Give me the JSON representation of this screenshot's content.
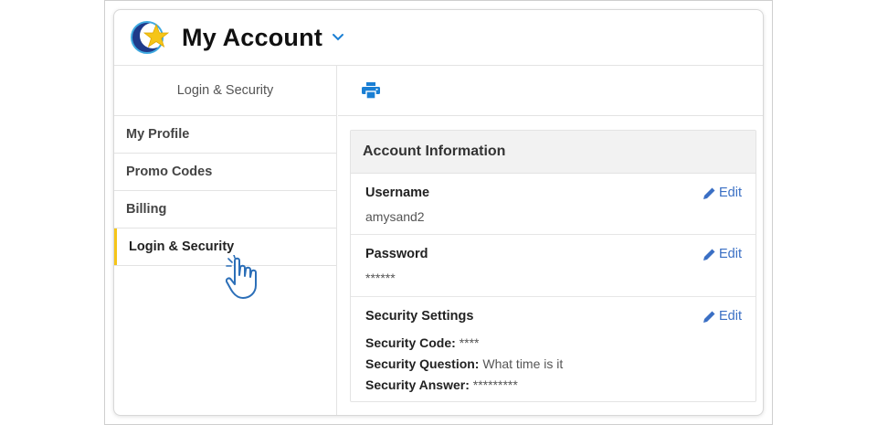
{
  "header": {
    "title": "My Account",
    "logo_icon": "star-crescent-logo",
    "dropdown_icon": "chevron-down-icon"
  },
  "sidebar": {
    "heading": "Login & Security",
    "items": [
      {
        "label": "My Profile",
        "active": false
      },
      {
        "label": "Promo Codes",
        "active": false
      },
      {
        "label": "Billing",
        "active": false
      },
      {
        "label": "Login & Security",
        "active": true
      }
    ],
    "active_accent": "#f5c518"
  },
  "toolbar": {
    "print_icon": "print-icon"
  },
  "account": {
    "heading": "Account Information",
    "edit_label": "Edit",
    "username": {
      "label": "Username",
      "value": "amysand2"
    },
    "password": {
      "label": "Password",
      "value": "******"
    },
    "security": {
      "label": "Security Settings",
      "code_label": "Security Code:",
      "code_value": "****",
      "question_label": "Security Question:",
      "question_value": "What time is it",
      "answer_label": "Security Answer:",
      "answer_value": "*********"
    }
  },
  "colors": {
    "link": "#3a6fc4",
    "print_icon": "#1a7fd4",
    "accent": "#f5c518"
  }
}
